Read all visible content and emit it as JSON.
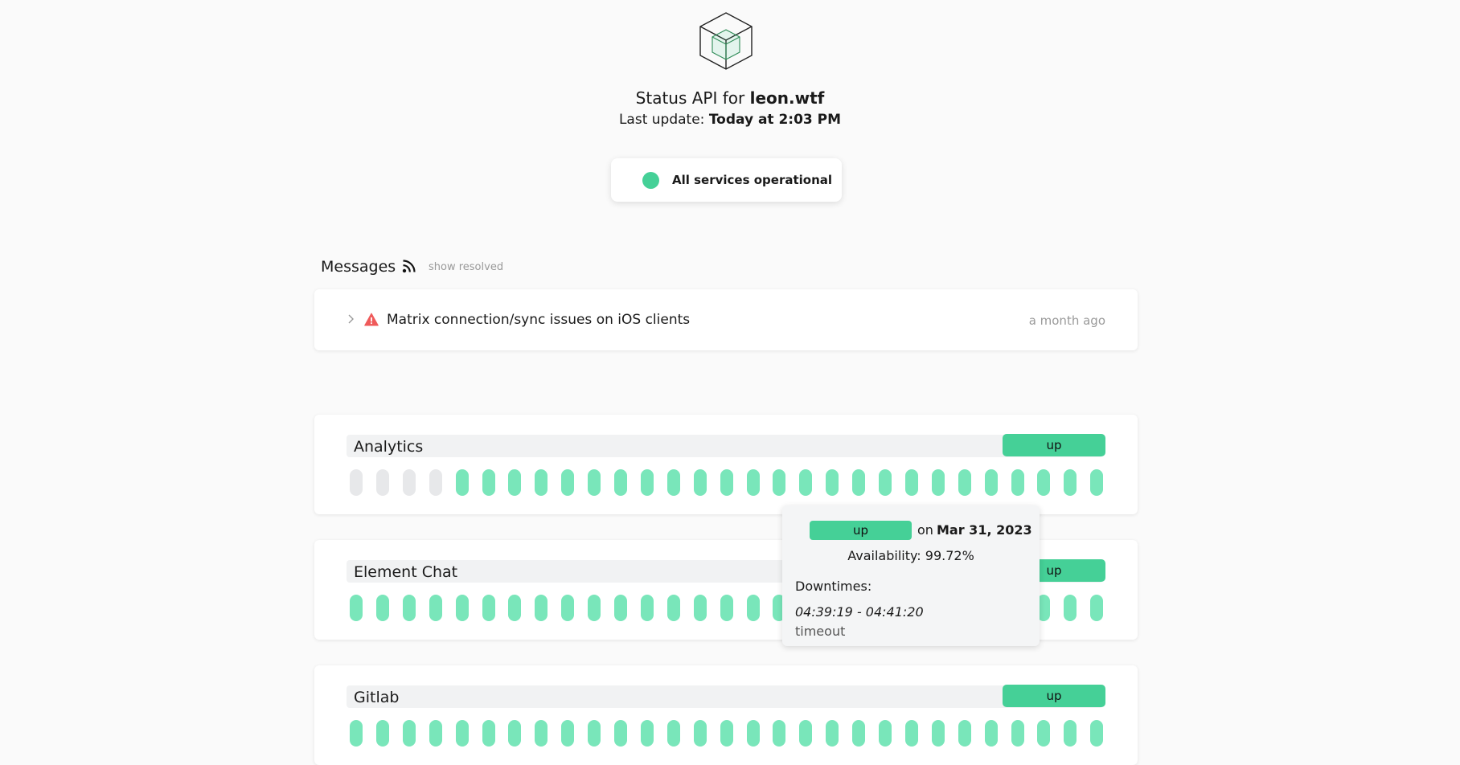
{
  "header": {
    "title_prefix": "Status API for ",
    "title_domain": "leon.wtf",
    "updated_label": "Last update: ",
    "updated_value": "Today at 2:03 PM"
  },
  "overall": {
    "text": "All services operational",
    "color": "#45d097"
  },
  "messages": {
    "heading": "Messages",
    "show_resolved": "show resolved",
    "items": [
      {
        "title": "Matrix connection/sync issues on iOS clients",
        "time": "a month ago",
        "icon": "warning-icon"
      }
    ]
  },
  "services": [
    {
      "name": "Analytics",
      "status": "up",
      "days": [
        "none",
        "none",
        "none",
        "none",
        "up",
        "up",
        "up",
        "up",
        "up",
        "up",
        "up",
        "up",
        "up",
        "up",
        "up",
        "up",
        "up",
        "up",
        "up",
        "up",
        "up",
        "up",
        "up",
        "up",
        "up",
        "up",
        "up",
        "up",
        "up"
      ]
    },
    {
      "name": "Element Chat",
      "status": "up",
      "days": [
        "up",
        "up",
        "up",
        "up",
        "up",
        "up",
        "up",
        "up",
        "up",
        "up",
        "up",
        "up",
        "up",
        "up",
        "up",
        "up",
        "up",
        "up",
        "up",
        "up",
        "up",
        "up",
        "up",
        "up",
        "up",
        "up",
        "up",
        "up",
        "up"
      ]
    },
    {
      "name": "Gitlab",
      "status": "up",
      "days": [
        "up",
        "up",
        "up",
        "up",
        "up",
        "up",
        "up",
        "up",
        "up",
        "up",
        "up",
        "up",
        "up",
        "up",
        "up",
        "up",
        "up",
        "up",
        "up",
        "up",
        "up",
        "up",
        "up",
        "up",
        "up",
        "up",
        "up",
        "up",
        "up"
      ]
    }
  ],
  "tooltip": {
    "status": "up",
    "on_label": "on",
    "date": "Mar 31, 2023",
    "availability": "Availability: 99.72%",
    "downtimes_label": "Downtimes:",
    "downtime_range": "04:39:19 - 04:41:20",
    "downtime_reason": "timeout"
  },
  "colors": {
    "up": "#45d097",
    "day_up": "#79e6ba",
    "day_none": "#e7e8ea",
    "warning": "#ef5a5a"
  }
}
